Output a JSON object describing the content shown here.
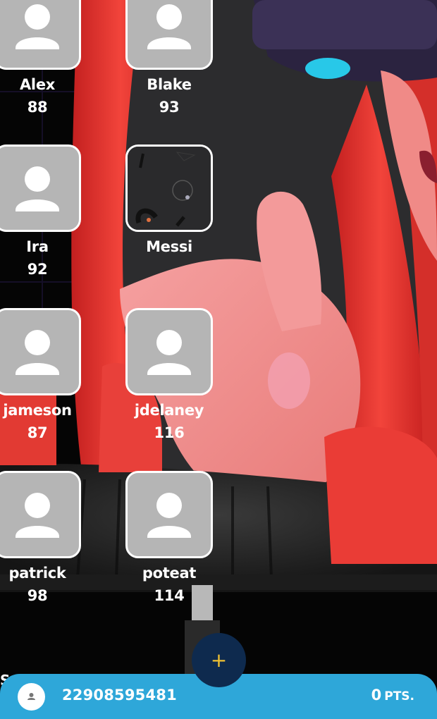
{
  "players": [
    {
      "name": "Alex",
      "score": "88",
      "avatar": "placeholder-person-icon"
    },
    {
      "name": "Blake",
      "score": "93",
      "avatar": "placeholder-person-icon"
    },
    {
      "name": "Ira",
      "score": "92",
      "avatar": "placeholder-person-icon"
    },
    {
      "name": "Messi",
      "score": "",
      "avatar": "custom-dark-image"
    },
    {
      "name": "jameson",
      "score": "87",
      "avatar": "placeholder-person-icon"
    },
    {
      "name": "jdelaney",
      "score": "116",
      "avatar": "placeholder-person-icon"
    },
    {
      "name": "patrick",
      "score": "98",
      "avatar": "placeholder-person-icon"
    },
    {
      "name": "poteat",
      "score": "114",
      "avatar": "placeholder-person-icon"
    }
  ],
  "clipped_label": "S",
  "bottom_bar": {
    "user_id": "22908595481",
    "points_value": "0",
    "points_unit": "PTS.",
    "avatar_icon": "user-icon"
  },
  "fab": {
    "label": "+",
    "icon": "plus-icon"
  },
  "colors": {
    "bar": "#2ea7d9",
    "fab": "#0e2a4e",
    "fab_plus": "#f1c232",
    "avatar_placeholder": "#b5b5b5",
    "chair_red": "#e8342f"
  }
}
